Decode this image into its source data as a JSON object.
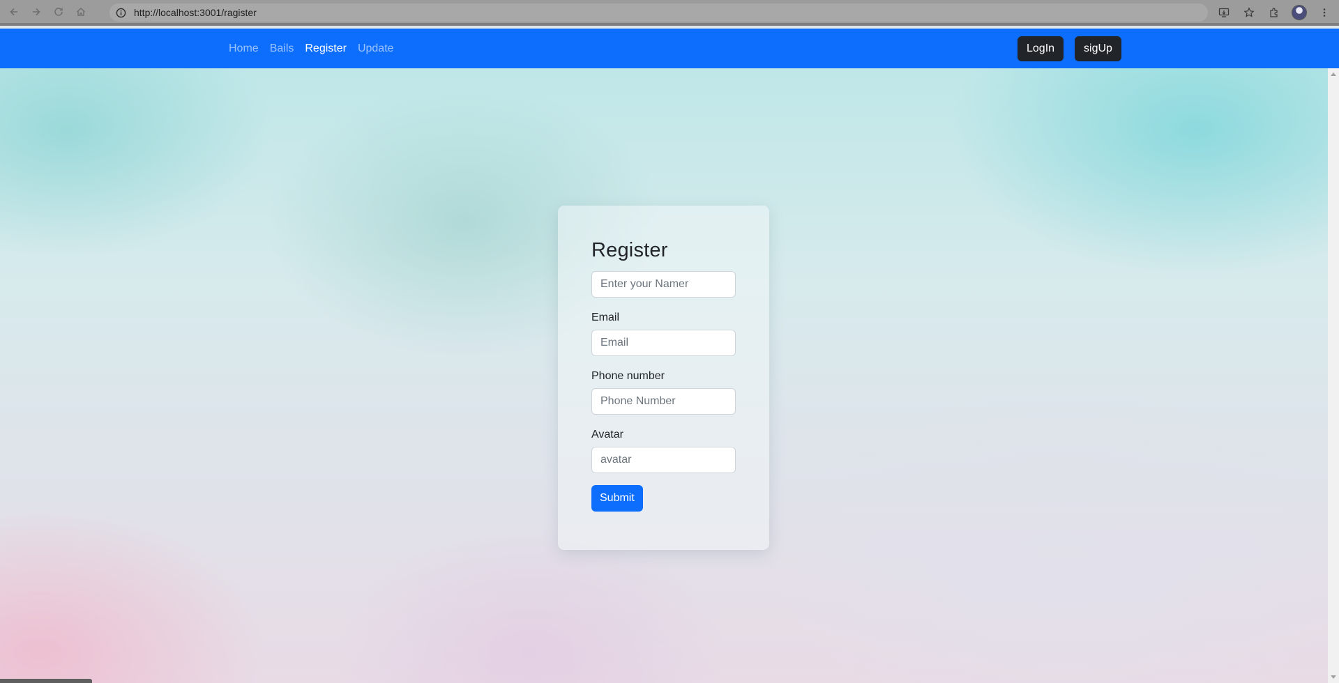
{
  "browser": {
    "url": "http://localhost:3001/ragister"
  },
  "navbar": {
    "links": [
      {
        "label": "Home"
      },
      {
        "label": "Bails"
      },
      {
        "label": "Register"
      },
      {
        "label": "Update"
      }
    ],
    "login_label": "LogIn",
    "signup_label": "sigUp"
  },
  "form": {
    "title": "Register",
    "name_placeholder": "Enter your Namer",
    "email_label": "Email",
    "email_placeholder": "Email",
    "phone_label": "Phone number",
    "phone_placeholder": "Phone Number",
    "avatar_label": "Avatar",
    "avatar_placeholder": "avatar",
    "submit_label": "Submit"
  },
  "colors": {
    "navbar_bg": "#0d6efd",
    "primary": "#0d6efd",
    "dark_button": "#212529"
  }
}
